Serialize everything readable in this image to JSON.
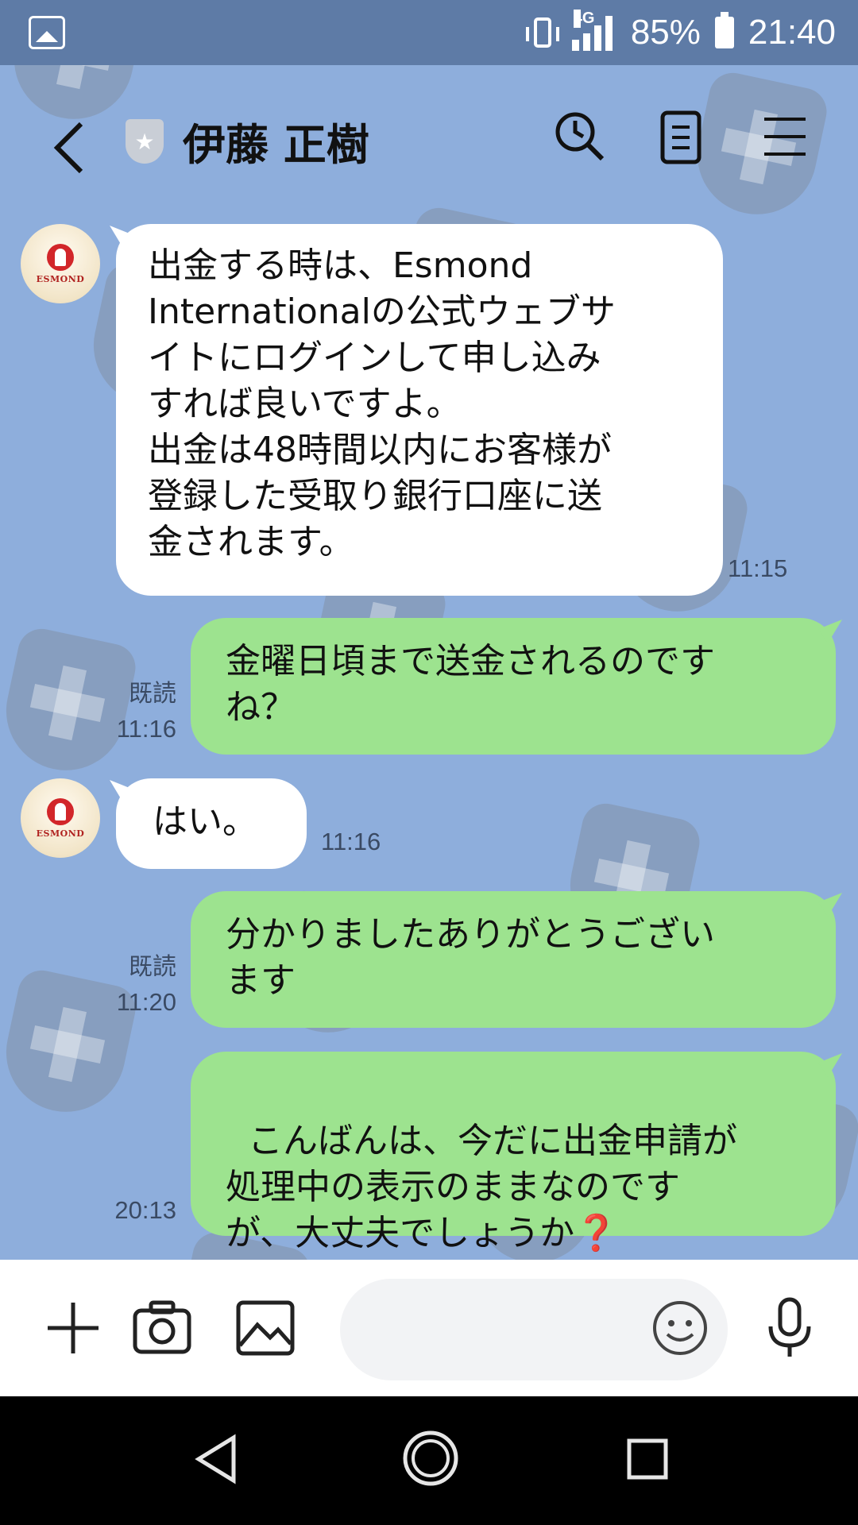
{
  "status_bar": {
    "network": "4G",
    "battery_percent": "85%",
    "time": "21:40"
  },
  "header": {
    "contact_name": "伊藤 正樹",
    "icons": [
      "back-icon",
      "shield-star-icon",
      "search-clock-icon",
      "note-icon",
      "menu-icon"
    ]
  },
  "avatar": {
    "logo_text": "ESMOND"
  },
  "messages": [
    {
      "direction": "incoming",
      "text": "出金する時は、Esmond\nInternationalの公式ウェブサ\nイトにログインして申し込み\nすれば良いですよ。\n出金は48時間以内にお客様が\n登録した受取り銀行口座に送\n金されます。",
      "time": "11:15"
    },
    {
      "direction": "outgoing",
      "text": "金曜日頃まで送金されるのです\nね？",
      "read": "既読",
      "time": "11:16"
    },
    {
      "direction": "incoming",
      "text": "はい。",
      "time": "11:16"
    },
    {
      "direction": "outgoing",
      "text": "分かりましたありがとうござい\nます",
      "read": "既読",
      "time": "11:20"
    },
    {
      "direction": "outgoing",
      "text": "こんばんは、今だに出金申請が\n処理中の表示のままなのです\nが、大丈夫でしょうか",
      "emoji": "❓",
      "time": "20:13"
    }
  ],
  "input_bar": {
    "value": "",
    "placeholder": "",
    "icons": [
      "plus-icon",
      "camera-icon",
      "image-icon",
      "emoji-icon",
      "microphone-icon"
    ]
  },
  "colors": {
    "background": "#8eaedc",
    "status_bar": "#5e7ba6",
    "outgoing_bubble": "#9de38f",
    "incoming_bubble": "#ffffff"
  }
}
